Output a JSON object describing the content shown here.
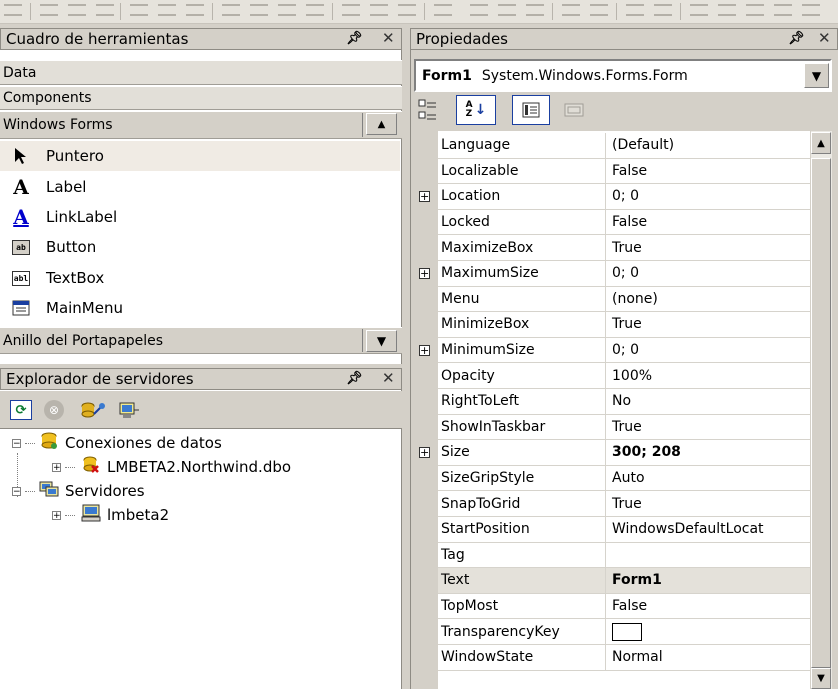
{
  "toolbox": {
    "title": "Cuadro de herramientas",
    "tabs": [
      "Data",
      "Components",
      "Windows Forms"
    ],
    "items": [
      {
        "label": "Puntero",
        "icon": "pointer-icon"
      },
      {
        "label": "Label",
        "icon": "label-icon"
      },
      {
        "label": "LinkLabel",
        "icon": "linklabel-icon"
      },
      {
        "label": "Button",
        "icon": "button-icon"
      },
      {
        "label": "TextBox",
        "icon": "textbox-icon"
      },
      {
        "label": "MainMenu",
        "icon": "mainmenu-icon"
      }
    ],
    "clipboard_tab": "Anillo del Portapapeles",
    "icon_glyphs": {
      "label": "A",
      "button": "ab",
      "textbox": "abl"
    }
  },
  "server_explorer": {
    "title": "Explorador de servidores",
    "tree": [
      {
        "label": "Conexiones de datos",
        "icon": "data-connections-icon",
        "expander": "−"
      },
      {
        "label": "LMBETA2.Northwind.dbo",
        "icon": "db-connection-icon",
        "expander": "+"
      },
      {
        "label": "Servidores",
        "icon": "servers-icon",
        "expander": "−"
      },
      {
        "label": "lmbeta2",
        "icon": "computer-icon",
        "expander": "+"
      }
    ]
  },
  "properties": {
    "title": "Propiedades",
    "object_name": "Form1",
    "object_type": "System.Windows.Forms.Form",
    "sort_icon_text": "A\nZ",
    "rows": [
      {
        "name": "Language",
        "value": "(Default)",
        "expandable": false,
        "bold": false
      },
      {
        "name": "Localizable",
        "value": "False",
        "expandable": false,
        "bold": false
      },
      {
        "name": "Location",
        "value": "0; 0",
        "expandable": true,
        "bold": false
      },
      {
        "name": "Locked",
        "value": "False",
        "expandable": false,
        "bold": false
      },
      {
        "name": "MaximizeBox",
        "value": "True",
        "expandable": false,
        "bold": false
      },
      {
        "name": "MaximumSize",
        "value": "0; 0",
        "expandable": true,
        "bold": false
      },
      {
        "name": "Menu",
        "value": "(none)",
        "expandable": false,
        "bold": false
      },
      {
        "name": "MinimizeBox",
        "value": "True",
        "expandable": false,
        "bold": false
      },
      {
        "name": "MinimumSize",
        "value": "0; 0",
        "expandable": true,
        "bold": false
      },
      {
        "name": "Opacity",
        "value": "100%",
        "expandable": false,
        "bold": false
      },
      {
        "name": "RightToLeft",
        "value": "No",
        "expandable": false,
        "bold": false
      },
      {
        "name": "ShowInTaskbar",
        "value": "True",
        "expandable": false,
        "bold": false
      },
      {
        "name": "Size",
        "value": "300; 208",
        "expandable": true,
        "bold": true
      },
      {
        "name": "SizeGripStyle",
        "value": "Auto",
        "expandable": false,
        "bold": false
      },
      {
        "name": "SnapToGrid",
        "value": "True",
        "expandable": false,
        "bold": false
      },
      {
        "name": "StartPosition",
        "value": "WindowsDefaultLocat",
        "expandable": false,
        "bold": false
      },
      {
        "name": "Tag",
        "value": "",
        "expandable": false,
        "bold": false
      },
      {
        "name": "Text",
        "value": "Form1",
        "expandable": false,
        "bold": true,
        "selected": true
      },
      {
        "name": "TopMost",
        "value": "False",
        "expandable": false,
        "bold": false
      },
      {
        "name": "TransparencyKey",
        "value": "",
        "expandable": false,
        "bold": false,
        "swatch": true
      },
      {
        "name": "WindowState",
        "value": "Normal",
        "expandable": false,
        "bold": false
      }
    ]
  },
  "colors": {
    "link_blue": "#0000cc",
    "selected_row": "#e4e1da",
    "panel_bg": "#d4d0c8"
  }
}
